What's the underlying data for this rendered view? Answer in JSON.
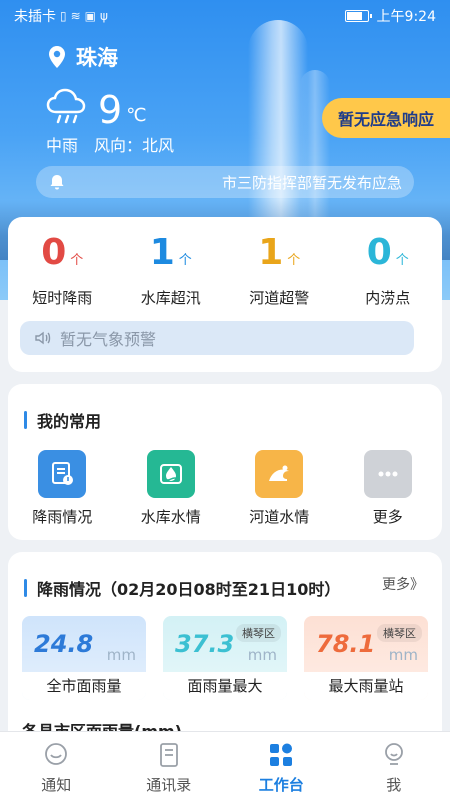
{
  "status_bar": {
    "carrier": "未插卡",
    "time": "上午9:24"
  },
  "location": "珠海",
  "weather": {
    "temp": "9",
    "unit": "℃",
    "condition": "中雨",
    "wind": "风向：北风"
  },
  "emergency_button": "暂无应急响应",
  "notice_text": "市三防指挥部暂无发布应急",
  "stats": [
    {
      "value": "0",
      "unit": "个",
      "label": "短时降雨"
    },
    {
      "value": "1",
      "unit": "个",
      "label": "水库超汛"
    },
    {
      "value": "1",
      "unit": "个",
      "label": "河道超警"
    },
    {
      "value": "0",
      "unit": "个",
      "label": "内涝点"
    }
  ],
  "weather_warning": "暂无气象预警",
  "favorites": {
    "title": "我的常用",
    "items": [
      {
        "label": "降雨情况",
        "icon": "rain-report-icon"
      },
      {
        "label": "水库水情",
        "icon": "reservoir-icon"
      },
      {
        "label": "河道水情",
        "icon": "river-icon"
      },
      {
        "label": "更多",
        "icon": "more-icon"
      }
    ]
  },
  "rainfall": {
    "title": "降雨情况（02月20日08时至21日10时）",
    "more": "更多》",
    "boxes": [
      {
        "value": "24.8",
        "unit": "mm",
        "tag": "",
        "caption": "全市面雨量"
      },
      {
        "value": "37.3",
        "unit": "mm",
        "tag": "横琴区",
        "caption": "面雨量最大"
      },
      {
        "value": "78.1",
        "unit": "mm",
        "tag": "横琴区",
        "caption": "最大雨量站"
      }
    ],
    "subtitle": "各县市区面雨量(mm)"
  },
  "tabs": [
    {
      "label": "通知"
    },
    {
      "label": "通讯录"
    },
    {
      "label": "工作台"
    },
    {
      "label": "我"
    }
  ],
  "colors": {
    "accent": "#1c7fe0",
    "emergency_bg": "#ffc84a",
    "red": "#e24a44",
    "blue": "#1d8ae0",
    "gold": "#e9a51a",
    "cyan": "#2bb6d8"
  }
}
